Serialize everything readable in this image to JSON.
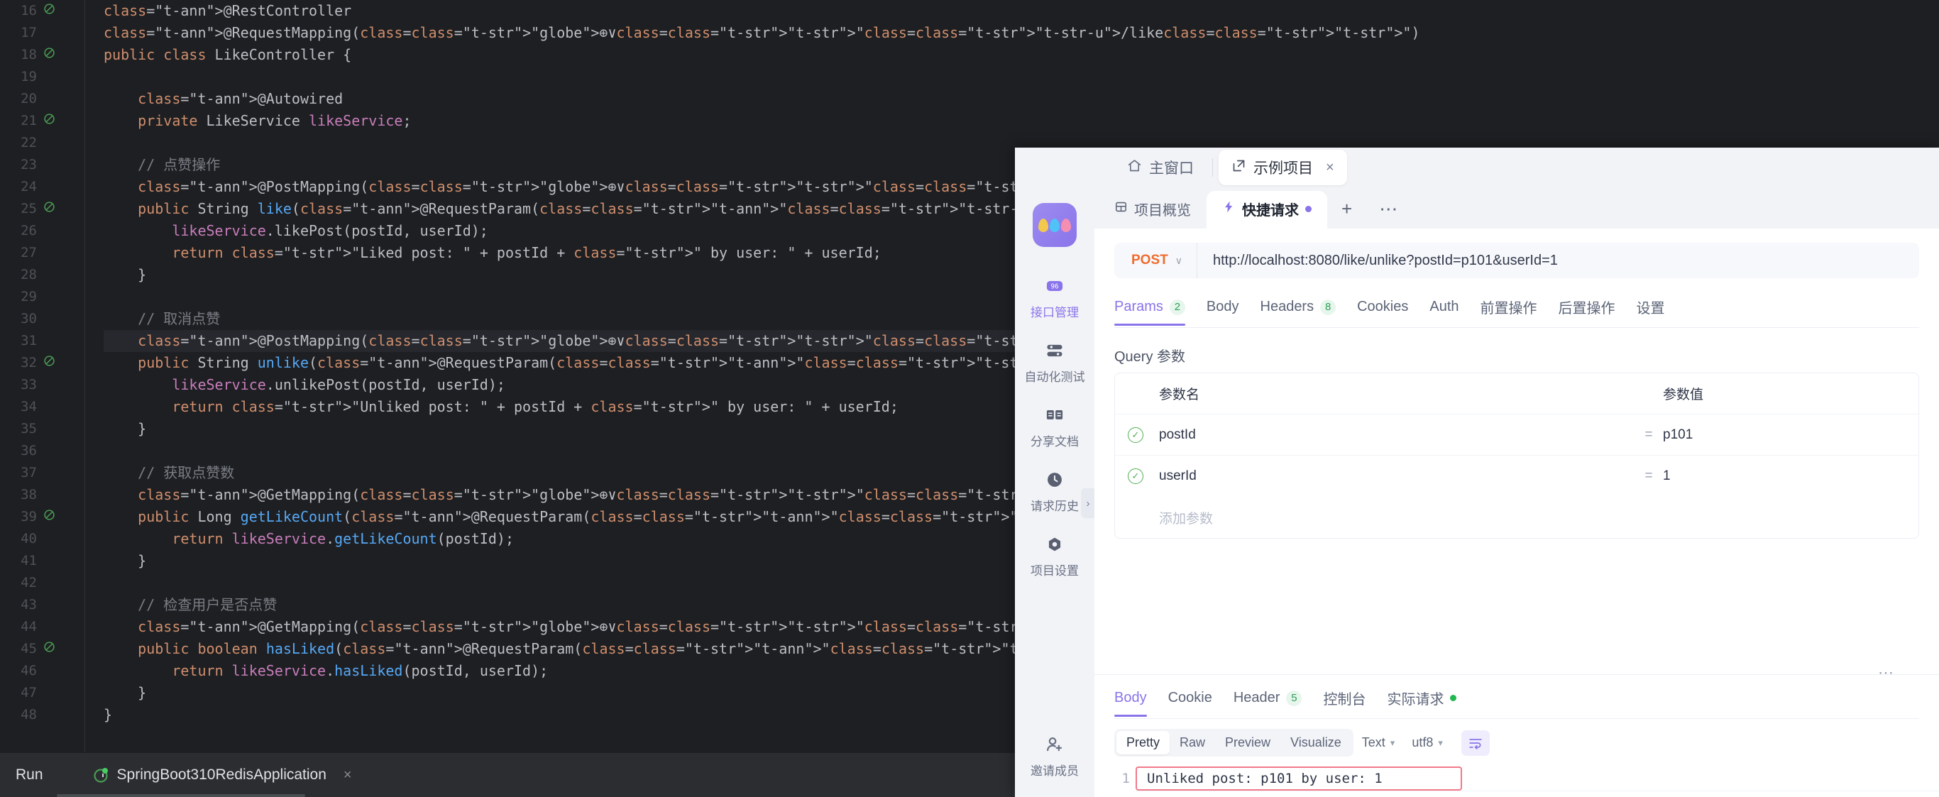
{
  "ide": {
    "run_panel": {
      "label": "Run",
      "tab_title": "SpringBoot310RedisApplication",
      "close": "×"
    },
    "code": {
      "file_lines": [
        {
          "n": "16",
          "marker": "◔",
          "text": "@RestController"
        },
        {
          "n": "17",
          "marker": "",
          "text": "@RequestMapping(⊕∨\"/like\")"
        },
        {
          "n": "18",
          "marker": "◔",
          "text": "public class LikeController {"
        },
        {
          "n": "19",
          "marker": "",
          "text": ""
        },
        {
          "n": "20",
          "marker": "",
          "text": "    @Autowired"
        },
        {
          "n": "21",
          "marker": "◔",
          "text": "    private LikeService likeService;"
        },
        {
          "n": "22",
          "marker": "",
          "text": ""
        },
        {
          "n": "23",
          "marker": "",
          "text": "    // 点赞操作"
        },
        {
          "n": "24",
          "marker": "",
          "text": "    @PostMapping(⊕∨\"/like\")"
        },
        {
          "n": "25",
          "marker": "◔",
          "text": "    public String like(@RequestParam(\"postId\") String postId, @RequestParam(\"userId\") String userId) {"
        },
        {
          "n": "26",
          "marker": "",
          "text": "        likeService.likePost(postId, userId);"
        },
        {
          "n": "27",
          "marker": "",
          "text": "        return \"Liked post: \" + postId + \" by user: \" + userId;"
        },
        {
          "n": "28",
          "marker": "",
          "text": "    }"
        },
        {
          "n": "29",
          "marker": "",
          "text": ""
        },
        {
          "n": "30",
          "marker": "",
          "text": "    // 取消点赞"
        },
        {
          "n": "31",
          "marker": "",
          "text": "    @PostMapping(⊕∨\"/unlike\")"
        },
        {
          "n": "32",
          "marker": "◔",
          "text": "    public String unlike(@RequestParam(\"postId\") String postId, @RequestParam(\"userId\") String userId) {"
        },
        {
          "n": "33",
          "marker": "",
          "text": "        likeService.unlikePost(postId, userId);"
        },
        {
          "n": "34",
          "marker": "",
          "text": "        return \"Unliked post: \" + postId + \" by user: \" + userId;"
        },
        {
          "n": "35",
          "marker": "",
          "text": "    }"
        },
        {
          "n": "36",
          "marker": "",
          "text": ""
        },
        {
          "n": "37",
          "marker": "",
          "text": "    // 获取点赞数"
        },
        {
          "n": "38",
          "marker": "",
          "text": "    @GetMapping(⊕∨\"/count\")"
        },
        {
          "n": "39",
          "marker": "◔",
          "text": "    public Long getLikeCount(@RequestParam(\"postId\") String postId) {"
        },
        {
          "n": "40",
          "marker": "",
          "text": "        return likeService.getLikeCount(postId);"
        },
        {
          "n": "41",
          "marker": "",
          "text": "    }"
        },
        {
          "n": "42",
          "marker": "",
          "text": ""
        },
        {
          "n": "43",
          "marker": "",
          "text": "    // 检查用户是否点赞"
        },
        {
          "n": "44",
          "marker": "",
          "text": "    @GetMapping(⊕∨\"/status\")"
        },
        {
          "n": "45",
          "marker": "◔",
          "text": "    public boolean hasLiked(@RequestParam(\"postId\") String postId, @RequestParam(\"userId\") String userId) {"
        },
        {
          "n": "46",
          "marker": "",
          "text": "        return likeService.hasLiked(postId, userId);"
        },
        {
          "n": "47",
          "marker": "",
          "text": "    }"
        },
        {
          "n": "48",
          "marker": "",
          "text": "}"
        }
      ],
      "selected_token": "unlike",
      "selected_line": "31"
    }
  },
  "api_client": {
    "window_tabs": [
      {
        "label": "主窗口",
        "icon": "home-icon",
        "active": false
      },
      {
        "label": "示例项目",
        "icon": "external-link-icon",
        "active": true,
        "closable": true
      }
    ],
    "sidebar": {
      "logo_name": "apifox-logo",
      "items": [
        {
          "label": "接口管理",
          "icon": "api-manage-icon",
          "active": true
        },
        {
          "label": "自动化测试",
          "icon": "automation-test-icon",
          "active": false
        },
        {
          "label": "分享文档",
          "icon": "share-doc-icon",
          "active": false
        },
        {
          "label": "请求历史",
          "icon": "clock-icon",
          "active": false
        },
        {
          "label": "项目设置",
          "icon": "settings-icon",
          "active": false
        },
        {
          "label": "邀请成员",
          "icon": "user-plus-icon",
          "active": false
        }
      ],
      "collapse_chevron": "›"
    },
    "project_tabs": [
      {
        "label": "项目概览",
        "icon": "overview-icon",
        "active": false,
        "dot": false
      },
      {
        "label": "快捷请求",
        "icon": "lightning-icon",
        "active": true,
        "dot": true
      }
    ],
    "project_tab_actions": {
      "add": "+",
      "more": "⋯"
    },
    "request": {
      "method": "POST",
      "method_chevron": "∨",
      "url": "http://localhost:8080/like/unlike?postId=p101&userId=1",
      "tabs": [
        {
          "label": "Params",
          "badge": "2",
          "active": true
        },
        {
          "label": "Body",
          "badge": "",
          "active": false
        },
        {
          "label": "Headers",
          "badge": "8",
          "active": false
        },
        {
          "label": "Cookies",
          "badge": "",
          "active": false
        },
        {
          "label": "Auth",
          "badge": "",
          "active": false
        },
        {
          "label": "前置操作",
          "badge": "",
          "active": false
        },
        {
          "label": "后置操作",
          "badge": "",
          "active": false
        },
        {
          "label": "设置",
          "badge": "",
          "active": false
        }
      ],
      "query_section_title": "Query 参数",
      "table": {
        "columns": [
          "参数名",
          "参数值"
        ],
        "equals_sign": "=",
        "rows": [
          {
            "enabled": true,
            "name": "postId",
            "value": "p101"
          },
          {
            "enabled": true,
            "name": "userId",
            "value": "1"
          }
        ],
        "add_row_placeholder": "添加参数"
      }
    },
    "response": {
      "overflow_dots": "⋯",
      "tabs": [
        {
          "label": "Body",
          "badge": "",
          "active": true,
          "dot": false
        },
        {
          "label": "Cookie",
          "badge": "",
          "active": false,
          "dot": false
        },
        {
          "label": "Header",
          "badge": "5",
          "active": false,
          "dot": false
        },
        {
          "label": "控制台",
          "badge": "",
          "active": false,
          "dot": false
        },
        {
          "label": "实际请求",
          "badge": "",
          "active": false,
          "dot": true
        }
      ],
      "format_segments": [
        {
          "label": "Pretty",
          "active": true
        },
        {
          "label": "Raw",
          "active": false
        },
        {
          "label": "Preview",
          "active": false
        },
        {
          "label": "Visualize",
          "active": false
        }
      ],
      "type_select": "Text",
      "encoding_select": "utf8",
      "wrap_icon": "wrap-lines-icon",
      "body_line_number": "1",
      "body_text": "Unliked post: p101 by user: 1"
    },
    "colors": {
      "accent": "#8a74ea",
      "method_post": "#ef6c2e",
      "success": "#21b851",
      "highlight_border": "#f2788b"
    }
  }
}
